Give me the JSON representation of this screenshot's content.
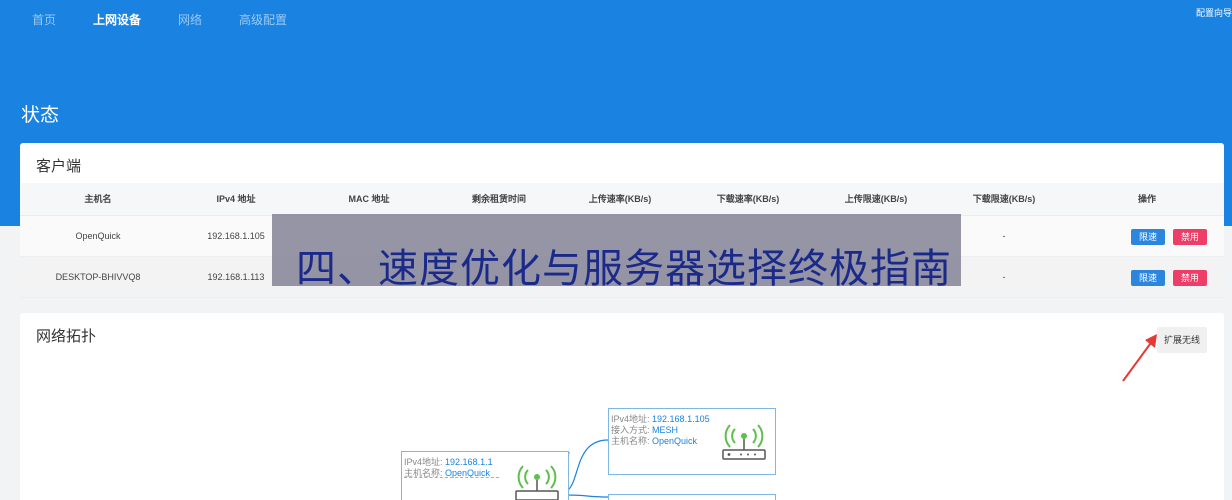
{
  "nav": {
    "items": [
      "首页",
      "上网设备",
      "网络",
      "高级配置"
    ],
    "active_index": 1,
    "wizard_link": "配置向导"
  },
  "page": {
    "title": "状态"
  },
  "clients": {
    "title": "客户端",
    "columns": [
      "主机名",
      "IPv4 地址",
      "MAC 地址",
      "剩余租赁时间",
      "上传速率(KB/s)",
      "下载速率(KB/s)",
      "上传限速(KB/s)",
      "下载限速(KB/s)",
      "操作"
    ],
    "rows": [
      {
        "hostname": "OpenQuick",
        "ipv4": "192.168.1.105",
        "download_limit": "-"
      },
      {
        "hostname": "DESKTOP-BHIVVQ8",
        "ipv4": "192.168.1.113",
        "download_limit": "-"
      }
    ],
    "limit_button": "限速",
    "disable_button": "禁用"
  },
  "overlay": {
    "text": "四、速度优化与服务器选择终极指南"
  },
  "topology": {
    "title": "网络拓扑",
    "expand_button": "扩展无线",
    "main_node": {
      "ip_label": "IPv4地址:",
      "ip": "192.168.1.1",
      "host_label": "主机名称:",
      "host": "OpenQuick"
    },
    "child_node": {
      "ip_label": "IPv4地址:",
      "ip": "192.168.1.105",
      "access_label": "接入方式:",
      "access": "MESH",
      "host_label": "主机名称:",
      "host": "OpenQuick"
    }
  },
  "colors": {
    "header_blue": "#1a82e0",
    "limit_blue": "#2d86dd",
    "disable_red": "#ee3e68",
    "wifi_green": "#5cc04a",
    "arrow_red": "#e53935"
  }
}
